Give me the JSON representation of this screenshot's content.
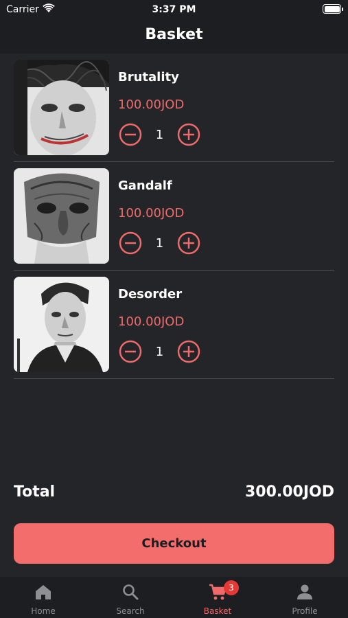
{
  "status_bar": {
    "carrier": "Carrier",
    "time": "3:37 PM"
  },
  "header": {
    "title": "Basket"
  },
  "items": [
    {
      "name": "Brutality",
      "price": "100.00JOD",
      "quantity": "1",
      "image": "joker-sketch"
    },
    {
      "name": "Gandalf",
      "price": "100.00JOD",
      "quantity": "1",
      "image": "old-man-sketch"
    },
    {
      "name": "Desorder",
      "price": "100.00JOD",
      "quantity": "1",
      "image": "portrait-sketch"
    }
  ],
  "summary": {
    "total_label": "Total",
    "total_value": "300.00JOD"
  },
  "checkout": {
    "label": "Checkout"
  },
  "tabs": [
    {
      "label": "Home",
      "icon": "home-icon",
      "active": false
    },
    {
      "label": "Search",
      "icon": "search-icon",
      "active": false
    },
    {
      "label": "Basket",
      "icon": "cart-icon",
      "active": true,
      "badge": "3"
    },
    {
      "label": "Profile",
      "icon": "person-icon",
      "active": false
    }
  ],
  "colors": {
    "background": "#242528",
    "bars": "#1d1e21",
    "accent": "#ef6b6b",
    "checkout": "#f36d6d",
    "badge": "#e53935",
    "inactive_tab": "#8e8e93"
  }
}
